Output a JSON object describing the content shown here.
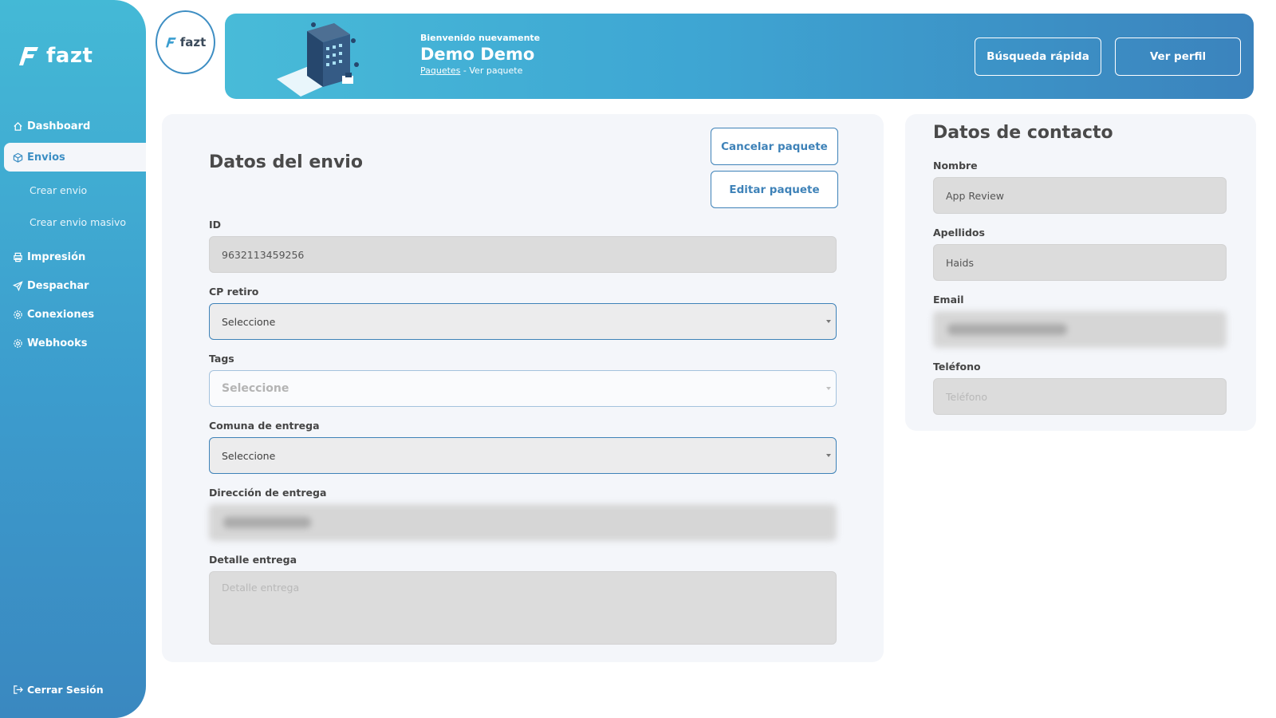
{
  "app": {
    "logo_text": "fazt"
  },
  "sidebar": {
    "items": [
      {
        "label": "Dashboard",
        "icon": "home-icon"
      },
      {
        "label": "Envios",
        "icon": "box-icon",
        "active": true
      },
      {
        "label": "Impresión",
        "icon": "printer-icon"
      },
      {
        "label": "Despachar",
        "icon": "send-icon"
      },
      {
        "label": "Conexiones",
        "icon": "gear-icon"
      },
      {
        "label": "Webhooks",
        "icon": "gear-icon"
      }
    ],
    "sub_items": [
      "Crear envio",
      "Crear envio masivo"
    ],
    "logout": "Cerrar Sesión"
  },
  "header": {
    "welcome": "Bienvenido nuevamente",
    "user_name": "Demo Demo",
    "breadcrumb_link": "Paquetes",
    "breadcrumb_separator": " - ",
    "breadcrumb_current": "Ver paquete",
    "quick_search": "Búsqueda rápida",
    "view_profile": "Ver perfil"
  },
  "shipment": {
    "title": "Datos del envio",
    "cancel_button": "Cancelar paquete",
    "edit_button": "Editar paquete",
    "id_label": "ID",
    "id_value": "9632113459256",
    "cp_label": "CP retiro",
    "cp_value": "Seleccione",
    "tags_label": "Tags",
    "tags_value": "Seleccione",
    "comuna_label": "Comuna de entrega",
    "comuna_value": "Seleccione",
    "address_label": "Dirección de entrega",
    "detail_label": "Detalle entrega",
    "detail_placeholder": "Detalle entrega"
  },
  "contact": {
    "title": "Datos de contacto",
    "name_label": "Nombre",
    "name_value": "App Review",
    "last_label": "Apellidos",
    "last_value": "Haids",
    "email_label": "Email",
    "phone_label": "Teléfono",
    "phone_placeholder": "Teléfono"
  },
  "colors": {
    "sidebar_top": "#44b9d6",
    "sidebar_bottom": "#3a88c0",
    "accent": "#3e82b8",
    "card_bg": "#f4f6fa",
    "field_bg": "#dcdcdc"
  }
}
